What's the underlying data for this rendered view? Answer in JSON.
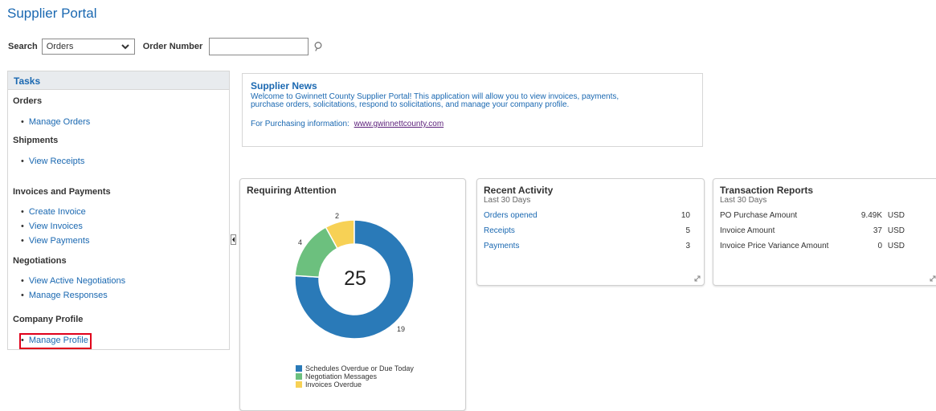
{
  "app": {
    "title": "Supplier Portal"
  },
  "search": {
    "label": "Search",
    "selected": "Orders",
    "order_number_label": "Order Number",
    "order_number_value": ""
  },
  "tasks": {
    "header": "Tasks",
    "sections": [
      {
        "title": "Orders",
        "items": [
          "Manage Orders"
        ]
      },
      {
        "title": "Shipments",
        "items": [
          "View Receipts"
        ]
      },
      {
        "title": "Invoices and Payments",
        "items": [
          "Create Invoice",
          "View Invoices",
          "View Payments"
        ]
      },
      {
        "title": "Negotiations",
        "items": [
          "View Active Negotiations",
          "Manage Responses"
        ]
      },
      {
        "title": "Company Profile",
        "items": [
          "Manage Profile"
        ]
      }
    ]
  },
  "news": {
    "title": "Supplier News",
    "line1": "Welcome to Gwinnett County Supplier Portal!  This application will allow you to view invoices, payments,",
    "line2": "purchase orders, solicitations, respond to solicitations, and manage your company profile.",
    "info_label": "For Purchasing information:",
    "info_link": "www.gwinnettcounty.com"
  },
  "attention": {
    "title": "Requiring Attention",
    "total": "25",
    "segments": [
      {
        "name": "Schedules Overdue or Due Today",
        "value": 19,
        "color": "#2a7ab8"
      },
      {
        "name": "Negotiation Messages",
        "value": 4,
        "color": "#6cc07e"
      },
      {
        "name": "Invoices Overdue",
        "value": 2,
        "color": "#f7d155"
      }
    ]
  },
  "recent": {
    "title": "Recent Activity",
    "subtitle": "Last 30 Days",
    "rows": [
      {
        "label": "Orders opened",
        "value": "10"
      },
      {
        "label": "Receipts",
        "value": "5"
      },
      {
        "label": "Payments",
        "value": "3"
      }
    ]
  },
  "reports": {
    "title": "Transaction Reports",
    "subtitle": "Last 30 Days",
    "rows": [
      {
        "label": "PO Purchase Amount",
        "value": "9.49K",
        "unit": "USD"
      },
      {
        "label": "Invoice Amount",
        "value": "37",
        "unit": "USD"
      },
      {
        "label": "Invoice Price Variance Amount",
        "value": "0",
        "unit": "USD"
      }
    ]
  },
  "colors": {
    "link": "#1a68b1",
    "highlight": "#e0001b"
  }
}
